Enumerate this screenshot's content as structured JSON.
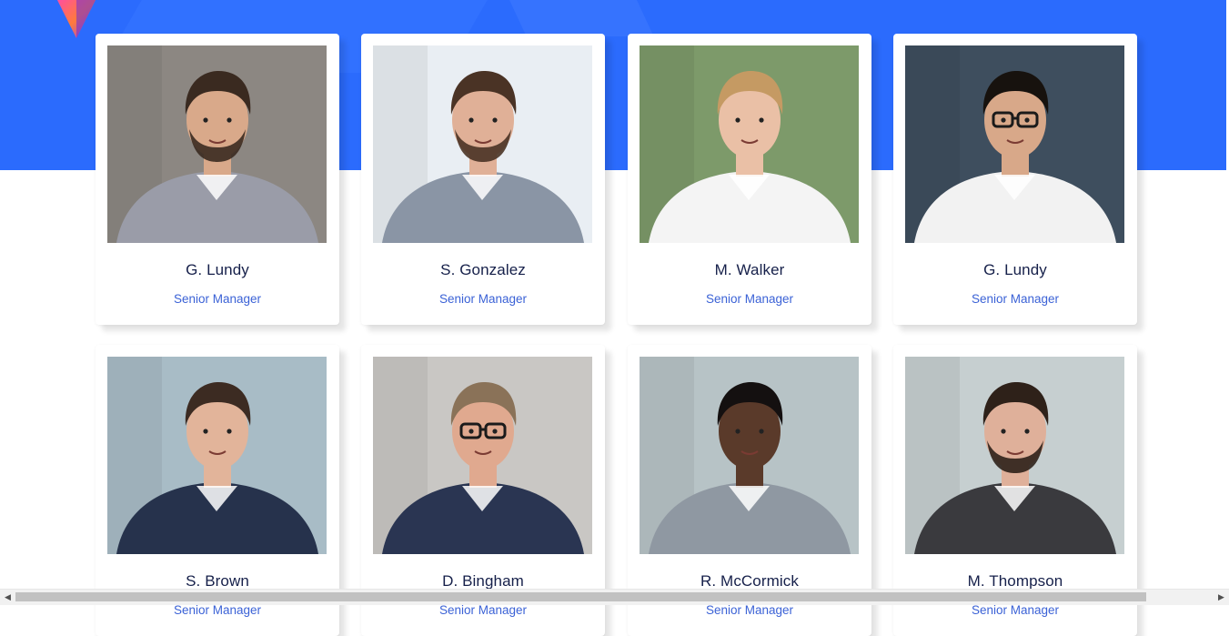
{
  "colors": {
    "hero": "#2b6bfd",
    "name_text": "#16204a",
    "role_text": "#3b62d6",
    "card_bg": "#ffffff"
  },
  "team": [
    {
      "name": "G. Lundy",
      "role": "Senior Manager",
      "photo": "portrait-man-beard-striped-shirt",
      "bg": "#8c8782",
      "skin": "#d9a98a",
      "hair": "#3a2a20",
      "cloth": "#9a9ca8",
      "beard": true,
      "glasses": false
    },
    {
      "name": "S. Gonzalez",
      "role": "Senior Manager",
      "photo": "portrait-man-beard-plaid-shirt",
      "bg": "#e9eef3",
      "skin": "#e0b097",
      "hair": "#4a3325",
      "cloth": "#8a95a5",
      "beard": true,
      "glasses": false
    },
    {
      "name": "M. Walker",
      "role": "Senior Manager",
      "photo": "portrait-woman-white-blouse",
      "bg": "#7d9a6a",
      "skin": "#eac0a6",
      "hair": "#c59a63",
      "cloth": "#f4f4f4",
      "beard": false,
      "glasses": false
    },
    {
      "name": "G. Lundy",
      "role": "Senior Manager",
      "photo": "portrait-man-glasses-white-shirt",
      "bg": "#3e4e5e",
      "skin": "#d8a889",
      "hair": "#17120e",
      "cloth": "#f2f2f2",
      "beard": false,
      "glasses": true
    },
    {
      "name": "S. Brown",
      "role": "Senior Manager",
      "photo": "portrait-man-suit-tie",
      "bg": "#a8bcc6",
      "skin": "#e2b49a",
      "hair": "#3c2b22",
      "cloth": "#26324c",
      "beard": false,
      "glasses": false
    },
    {
      "name": "D. Bingham",
      "role": "Senior Manager",
      "photo": "portrait-older-man-glasses-red-tie",
      "bg": "#c9c7c4",
      "skin": "#e0a98f",
      "hair": "#8a7258",
      "cloth": "#2a3552",
      "beard": false,
      "glasses": true
    },
    {
      "name": "R. McCormick",
      "role": "Senior Manager",
      "photo": "portrait-man-grey-suit",
      "bg": "#b7c3c6",
      "skin": "#5a3a2a",
      "hair": "#141010",
      "cloth": "#8f98a2",
      "beard": false,
      "glasses": false
    },
    {
      "name": "M. Thompson",
      "role": "Senior Manager",
      "photo": "portrait-man-dark-suit",
      "bg": "#c6cfd0",
      "skin": "#dfb09a",
      "hair": "#2e2119",
      "cloth": "#3a3a3e",
      "beard": true,
      "glasses": false
    }
  ]
}
